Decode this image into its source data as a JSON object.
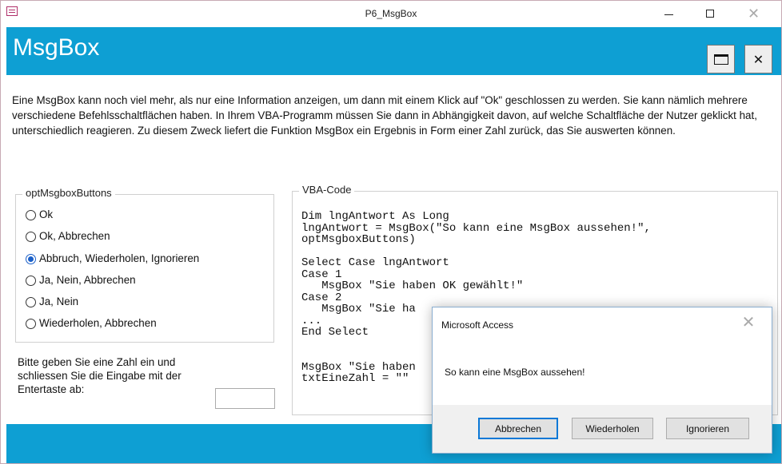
{
  "window": {
    "title": "P6_MsgBox"
  },
  "header": {
    "title": "MsgBox"
  },
  "description": "Eine MsgBox kann noch viel mehr, als nur eine Information anzeigen, um dann mit einem Klick auf \"Ok\" geschlossen zu werden. Sie kann nämlich mehrere verschiedene Befehlsschaltflächen haben. In Ihrem VBA-Programm müssen Sie dann in Abhängigkeit davon, auf welche Schaltfläche der Nutzer geklickt hat, unterschiedlich reagieren. Zu diesem Zweck liefert die Funktion MsgBox ein Ergebnis in Form einer Zahl zurück, das Sie auswerten können.",
  "options": {
    "legend": "optMsgboxButtons",
    "items": [
      {
        "label": "Ok",
        "selected": false
      },
      {
        "label": "Ok, Abbrechen",
        "selected": false
      },
      {
        "label": "Abbruch, Wiederholen, Ignorieren",
        "selected": true
      },
      {
        "label": "Ja, Nein, Abbrechen",
        "selected": false
      },
      {
        "label": "Ja, Nein",
        "selected": false
      },
      {
        "label": "Wiederholen, Abbrechen",
        "selected": false
      }
    ]
  },
  "prompt": {
    "text": "Bitte geben Sie eine Zahl ein und schliessen Sie die Eingabe mit der Entertaste  ab:",
    "value": ""
  },
  "code": {
    "legend": "VBA-Code",
    "text": "Dim lngAntwort As Long\nlngAntwort = MsgBox(\"So kann eine MsgBox aussehen!\",\noptMsgboxButtons)\n\nSelect Case lngAntwort\nCase 1\n   MsgBox \"Sie haben OK gewählt!\"\nCase 2\n   MsgBox \"Sie ha\n...\nEnd Select\n\n\nMsgBox \"Sie haben\ntxtEineZahl = \"\""
  },
  "dialog": {
    "title": "Microsoft Access",
    "message": "So kann eine MsgBox aussehen!",
    "buttons": {
      "abort": "Abbrechen",
      "retry": "Wiederholen",
      "ignore": "Ignorieren"
    }
  },
  "icons": {
    "app": "form-icon",
    "minimize": "minimize-icon",
    "maximize": "maximize-icon",
    "close": "close-icon",
    "form_maximize": "form-maximize-icon",
    "form_close": "form-close-icon"
  },
  "colors": {
    "accent": "#0e9fd3",
    "radio_selected": "#1a5fc8",
    "default_button_border": "#0a78d7"
  }
}
